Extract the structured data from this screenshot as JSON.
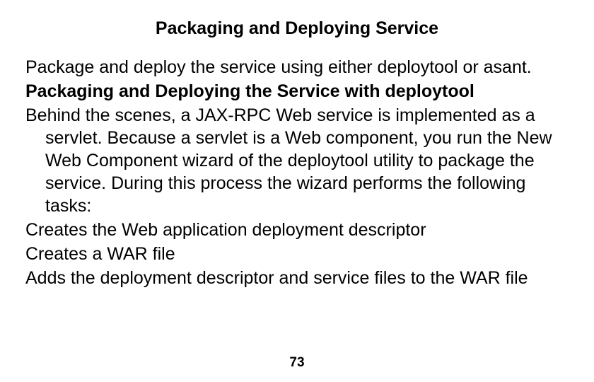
{
  "title": "Packaging and Deploying Service",
  "p1": "Package and deploy the service using either deploytool or asant.",
  "p2": "Packaging and Deploying the Service with deploytool",
  "p3": "Behind the scenes, a JAX-RPC Web service is implemented as a servlet. Because a servlet is a Web component, you run the New Web Component wizard of the deploytool utility to package the service. During this process the wizard performs the following tasks:",
  "p4": "Creates the Web application deployment descriptor",
  "p5": "Creates a WAR file",
  "p6": "Adds the deployment descriptor and service files to the WAR file",
  "page_number": "73"
}
